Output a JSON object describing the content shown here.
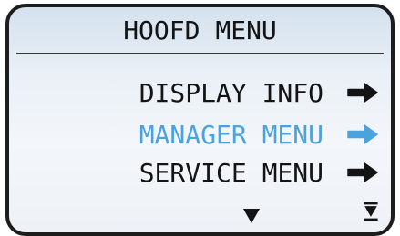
{
  "screen": {
    "title": "HOOFD MENU",
    "menu_items": [
      {
        "label": "DISPLAY INFO",
        "icon": "arrow-right-icon",
        "selected": false
      },
      {
        "label": "MANAGER MENU",
        "icon": "arrow-right-icon",
        "selected": true
      },
      {
        "label": "SERVICE MENU",
        "icon": "arrow-right-icon",
        "selected": false
      }
    ],
    "nav": {
      "down_icon": "triangle-down-icon",
      "end_icon": "scroll-to-end-icon"
    }
  },
  "colors": {
    "text": "#141414",
    "selected": "#4aa3dc",
    "border": "#1d1d1d",
    "background_top": "#d4e1ee",
    "background_bottom": "#eef2f7"
  }
}
